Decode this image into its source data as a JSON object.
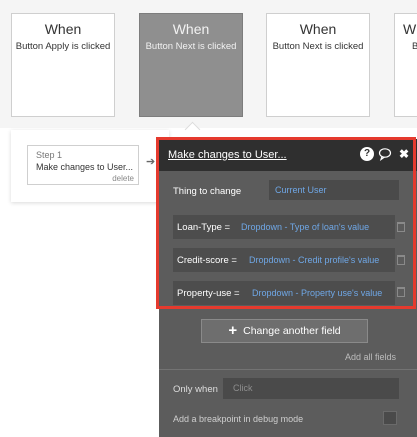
{
  "events": [
    {
      "when": "When",
      "desc": "Button Apply is clicked"
    },
    {
      "when": "When",
      "desc": "Button Next is clicked"
    },
    {
      "when": "When",
      "desc": "Button Next is clicked"
    },
    {
      "when": "When",
      "desc": "B"
    }
  ],
  "step": {
    "number": "Step 1",
    "title": "Make changes to User...",
    "delete": "delete",
    "arrow": "➔"
  },
  "panel": {
    "title": "Make changes to User...",
    "icons": {
      "help": "?",
      "comment": "comment-icon",
      "close": "✖"
    },
    "thing_label": "Thing to change",
    "thing_value": "Current User",
    "fields": [
      {
        "label": "Loan-Type  =",
        "value": "Dropdown - Type of loan's value"
      },
      {
        "label": "Credit-score  =",
        "value": "Dropdown - Credit profile's value"
      },
      {
        "label": "Property-use  =",
        "value": "Dropdown - Property use's value"
      }
    ],
    "change_button": "Change another field",
    "plus": "+",
    "add_all": "Add all fields",
    "only_when": "Only when",
    "condition_placeholder": "Click",
    "debug_label": "Add a breakpoint in debug mode"
  },
  "colors": {
    "highlight": "#e53a2e",
    "link_value": "#6fa7e6",
    "panel_bg": "#5c5c5c",
    "header_bg": "#2f2f2f"
  }
}
